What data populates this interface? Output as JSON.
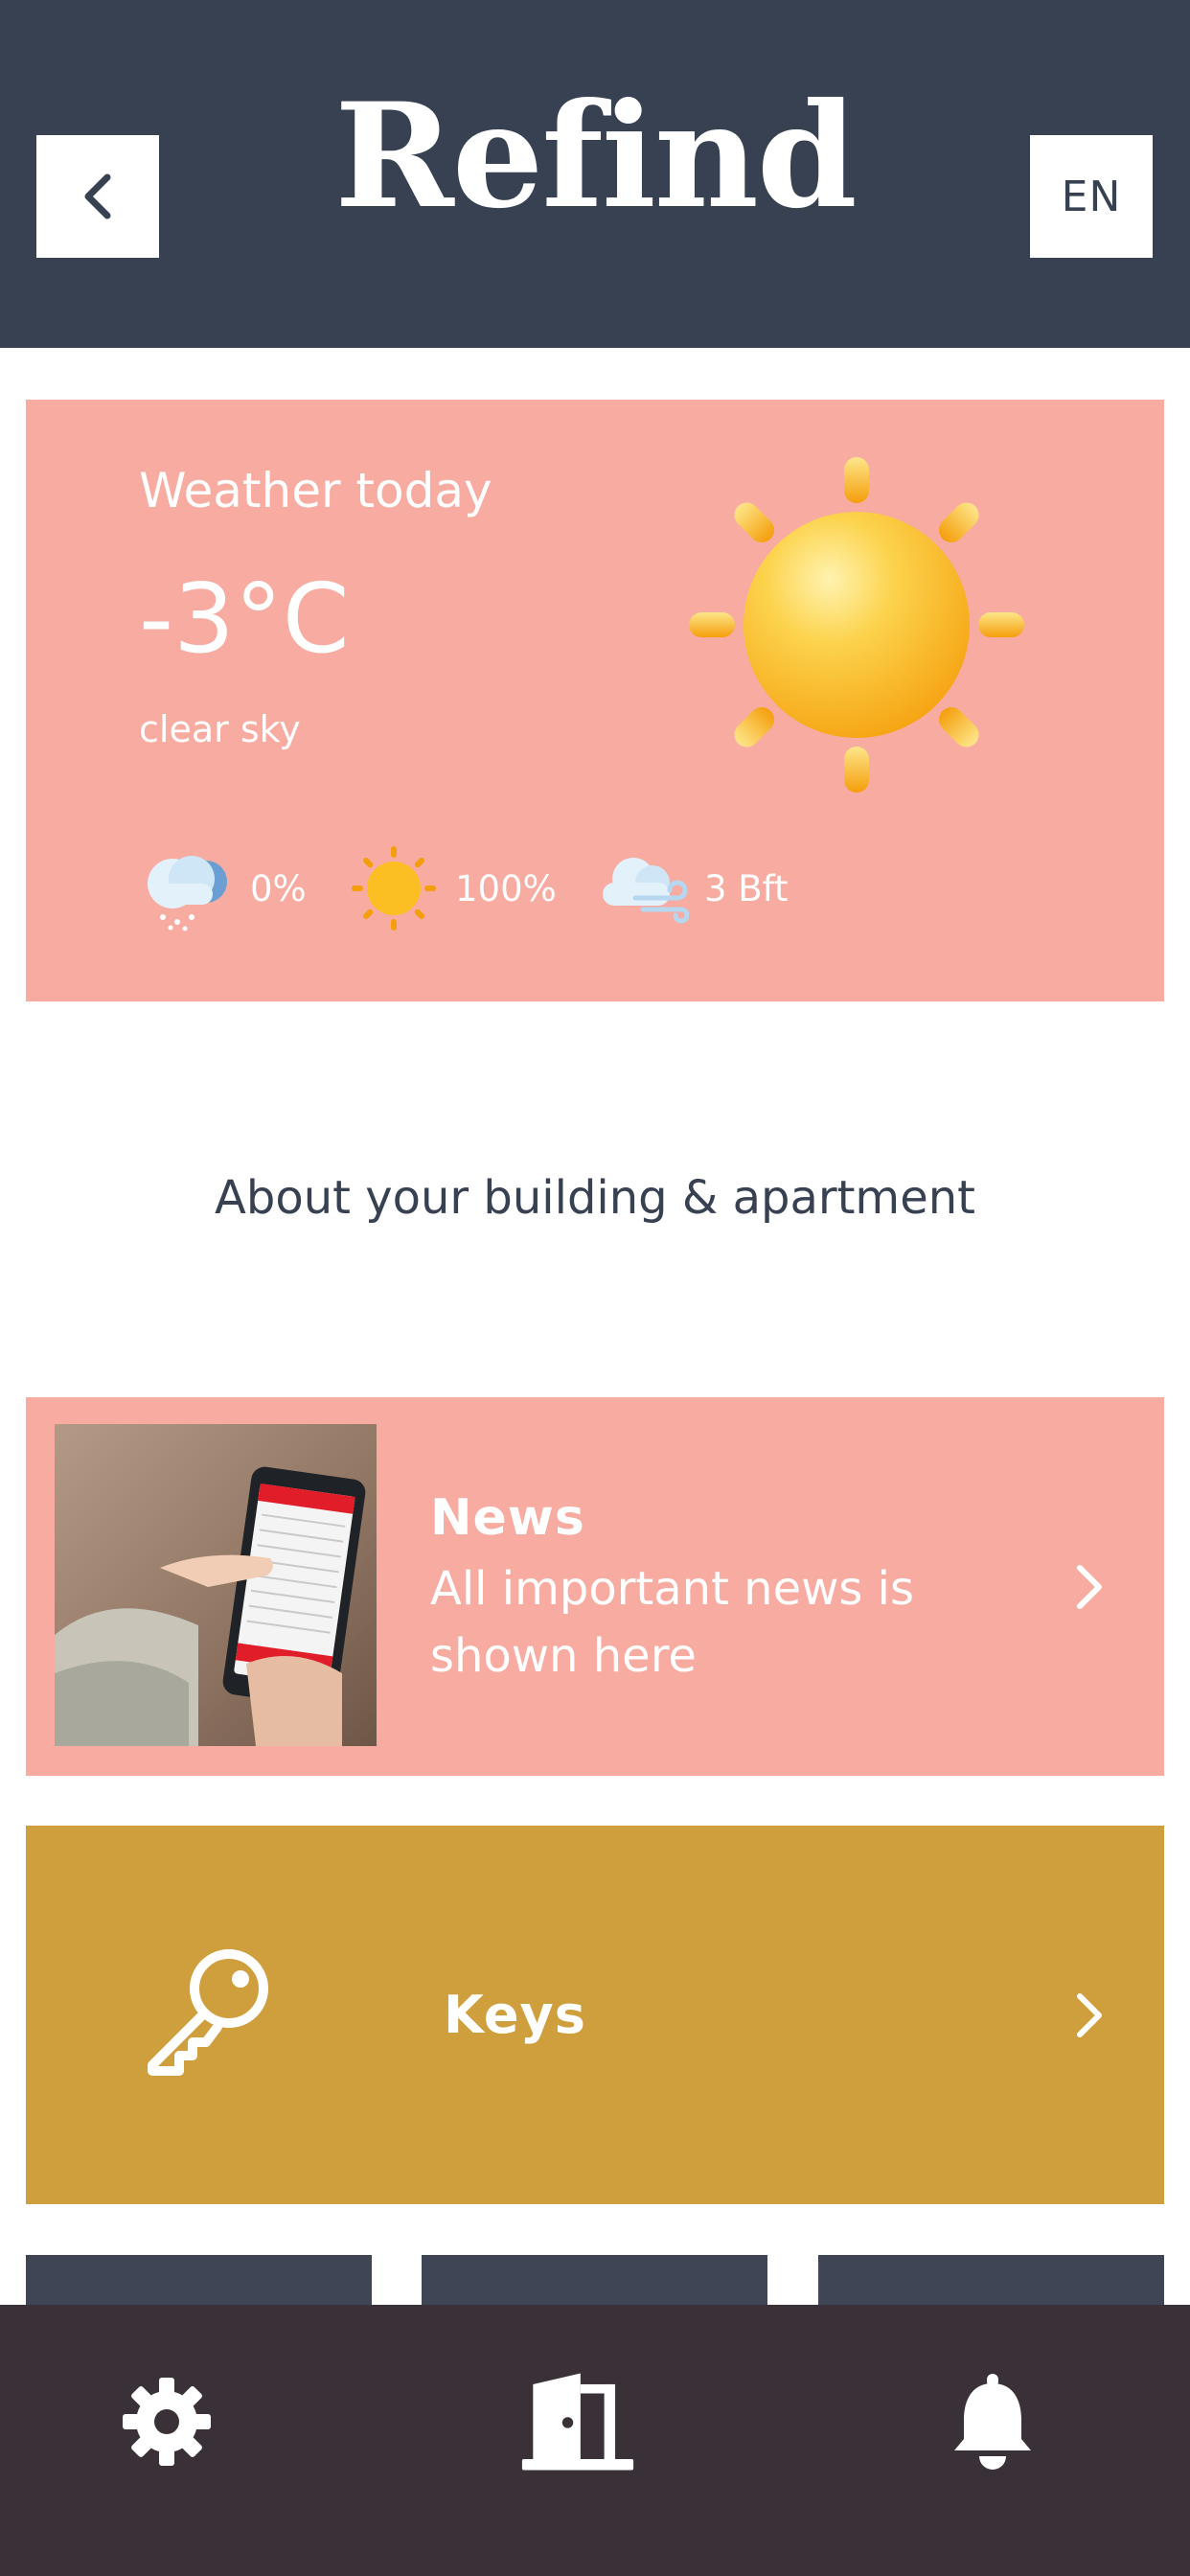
{
  "header": {
    "back_icon": "chevron-left-icon",
    "logo_text": "Refind",
    "language": "EN"
  },
  "weather": {
    "title": "Weather today",
    "temperature": "-3°C",
    "description": "clear sky",
    "main_icon": "sun-icon",
    "stats": [
      {
        "icon": "snow-cloud-icon",
        "value": "0%"
      },
      {
        "icon": "sun-icon",
        "value": "100%"
      },
      {
        "icon": "wind-cloud-icon",
        "value": "3 Bft"
      }
    ]
  },
  "section": {
    "title": "About your building & apartment"
  },
  "news": {
    "title": "News",
    "text": "All important news is shown here",
    "image": "hand-holding-smartphone-photo"
  },
  "keys": {
    "label": "Keys",
    "icon": "key-icon"
  },
  "bottom_nav": [
    {
      "icon": "gear-icon",
      "name": "settings"
    },
    {
      "icon": "door-icon",
      "name": "apartment"
    },
    {
      "icon": "bell-icon",
      "name": "notifications"
    }
  ],
  "colors": {
    "header_bg": "#374151",
    "pink": "#f7aba1",
    "gold": "#cf9f3e",
    "nav_bg": "#3a3037",
    "text_dark": "#374151",
    "sun_yellow": "#fbbf24"
  }
}
